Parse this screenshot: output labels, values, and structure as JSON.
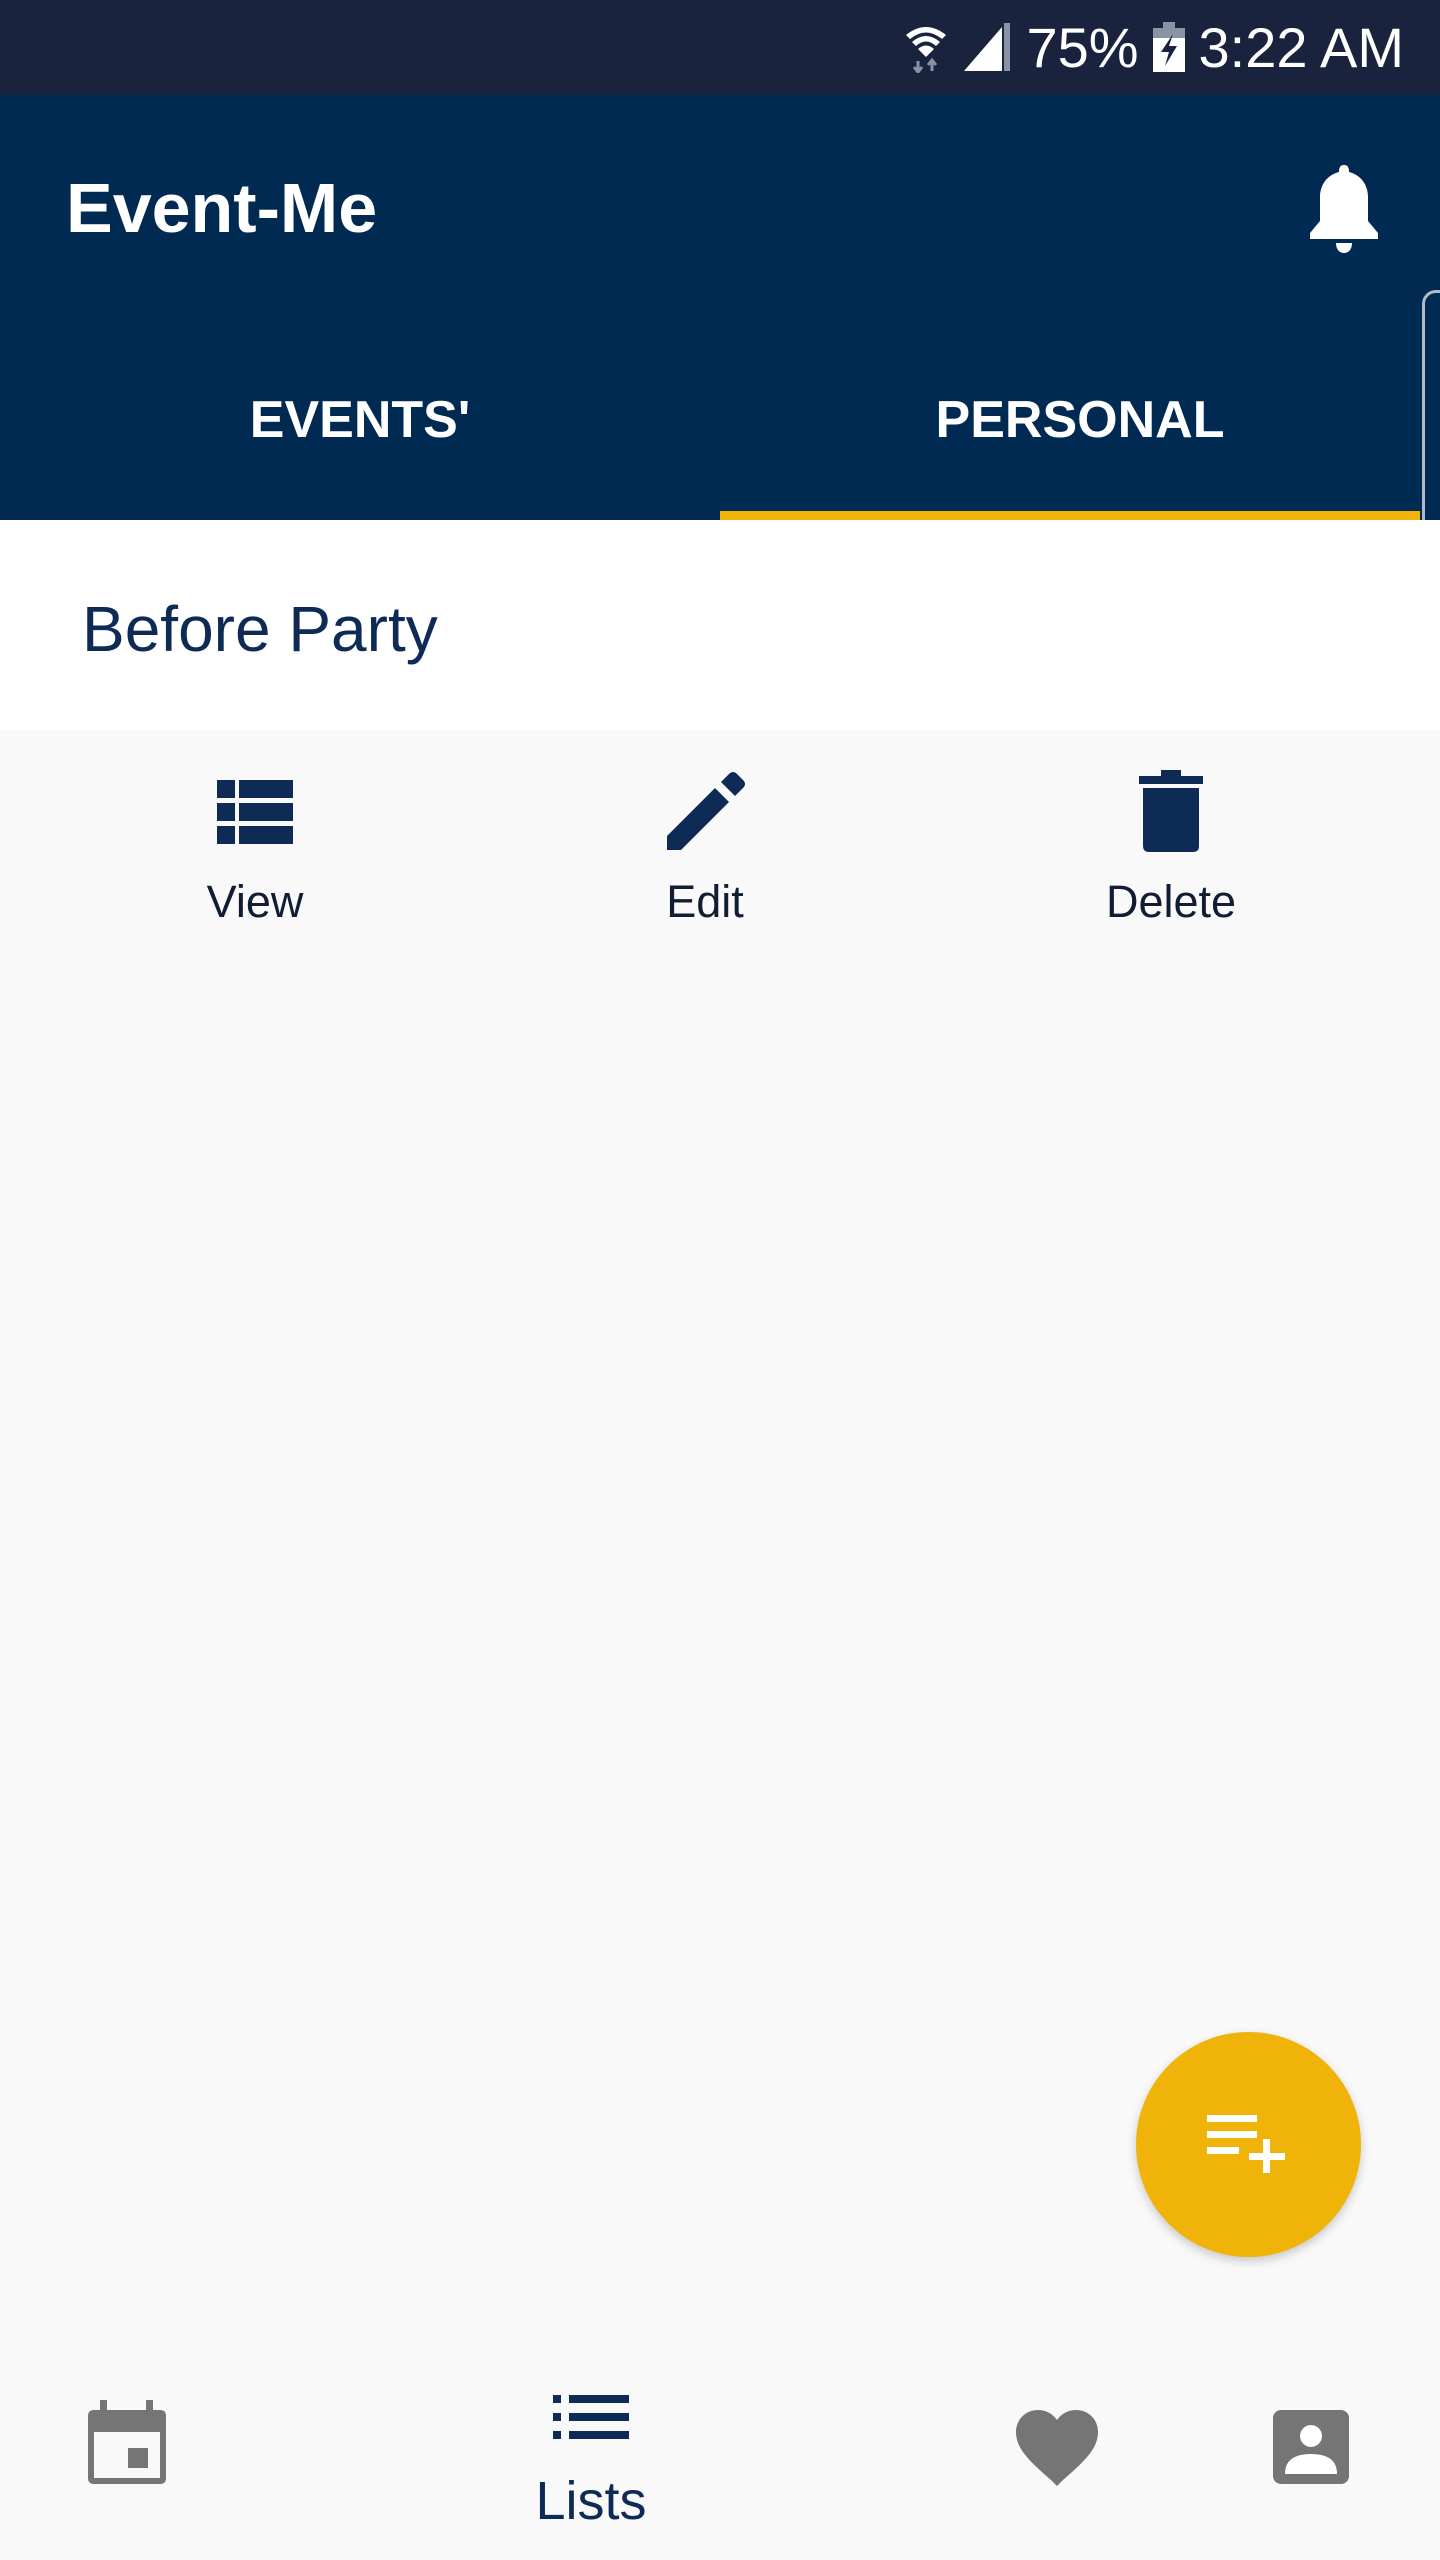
{
  "status_bar": {
    "battery": "75%",
    "time": "3:22 AM",
    "icons": [
      "wifi-icon",
      "signal-icon",
      "battery-charging-icon"
    ]
  },
  "app_bar": {
    "title": "Event-Me",
    "notification_icon": "bell-icon"
  },
  "tabs": [
    {
      "label": "EVENTS'",
      "selected": false
    },
    {
      "label": "PERSONAL",
      "selected": true
    }
  ],
  "list": {
    "items": [
      {
        "title": "Before Party",
        "actions": [
          {
            "label": "View",
            "icon": "view-list-icon"
          },
          {
            "label": "Edit",
            "icon": "pencil-icon"
          },
          {
            "label": "Delete",
            "icon": "trash-icon"
          }
        ]
      }
    ]
  },
  "fab": {
    "icon": "playlist-add-icon"
  },
  "bottom_nav": {
    "items": [
      {
        "icon": "calendar-icon",
        "label": ""
      },
      {
        "icon": "list-icon",
        "label": "Lists",
        "selected": true
      },
      {
        "icon": "heart-icon",
        "label": ""
      },
      {
        "icon": "contact-icon",
        "label": ""
      }
    ]
  },
  "colors": {
    "primary": "#002a52",
    "accent": "#f0b30a",
    "status_bar": "#19233d",
    "inactive_icon": "#757575"
  }
}
